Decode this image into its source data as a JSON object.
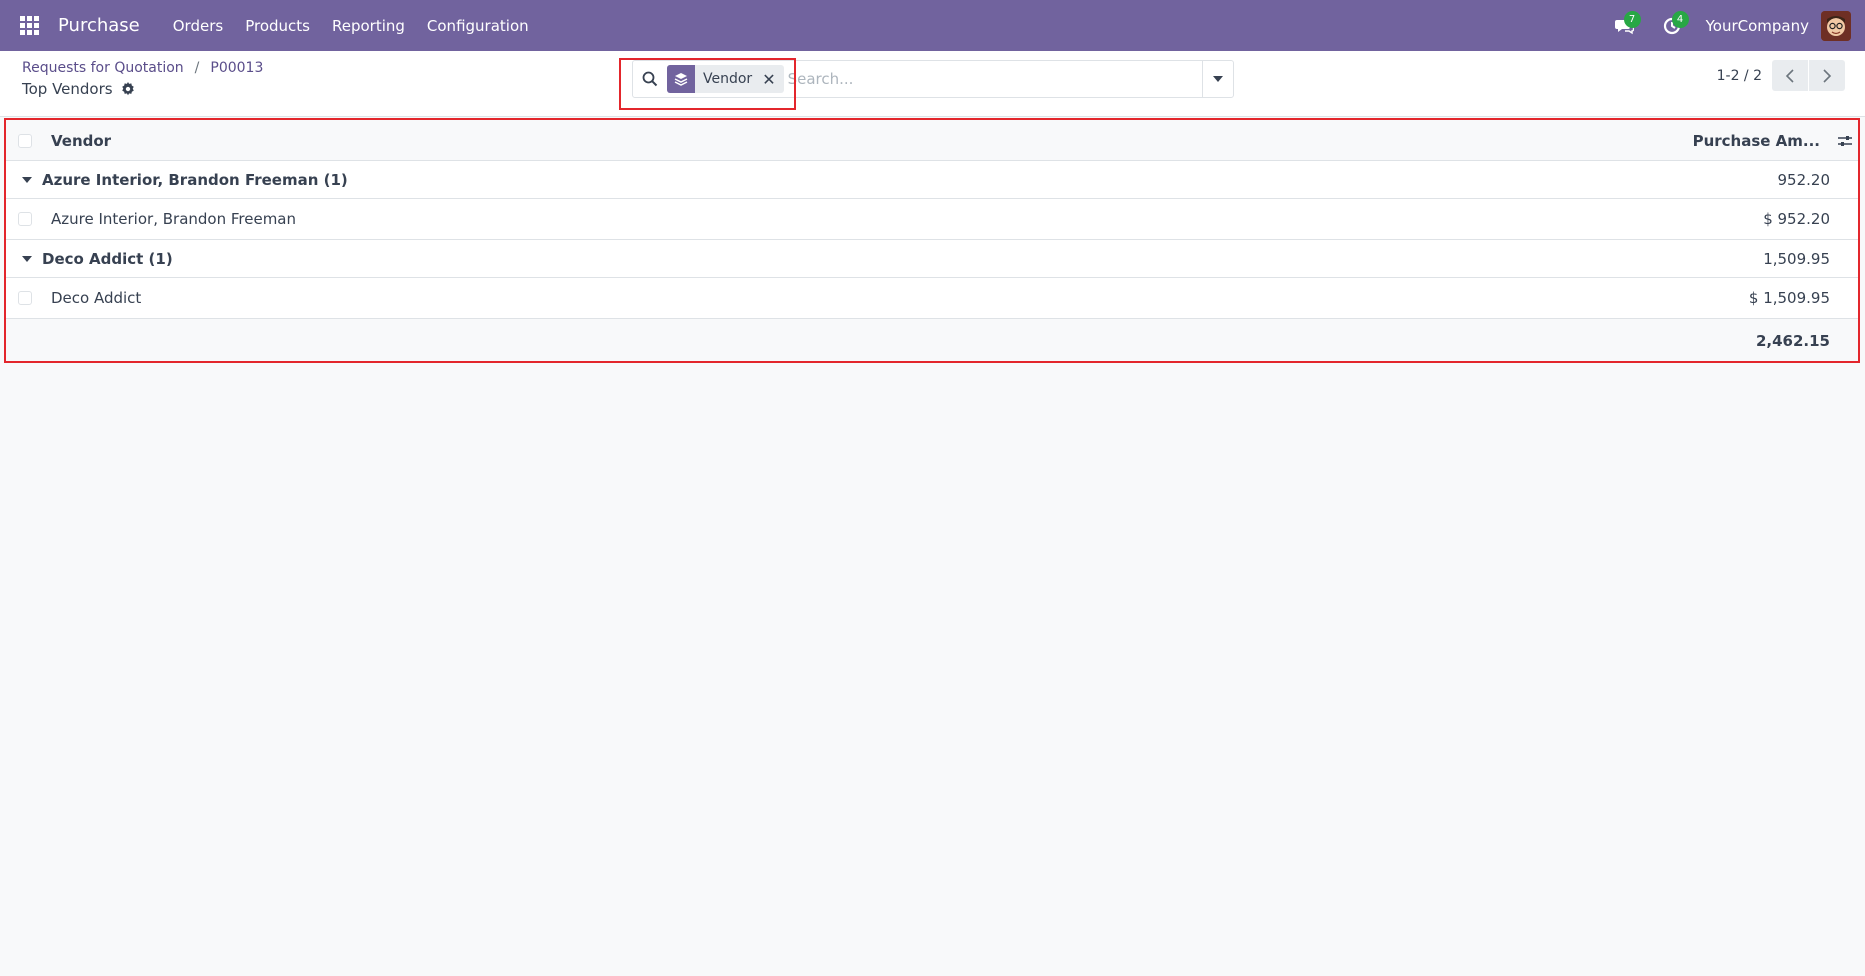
{
  "navbar": {
    "brand": "Purchase",
    "menu": [
      {
        "label": "Orders"
      },
      {
        "label": "Products"
      },
      {
        "label": "Reporting"
      },
      {
        "label": "Configuration"
      }
    ],
    "messages_count": "7",
    "activities_count": "4",
    "company": "YourCompany"
  },
  "breadcrumb": {
    "items": [
      "Requests for Quotation",
      "P00013"
    ],
    "separator": "/"
  },
  "page_title": "Top Vendors",
  "search": {
    "facet_label": "Vendor",
    "facet_remove": "✕",
    "placeholder": "Search..."
  },
  "pager": {
    "value": "1-2 / 2"
  },
  "list": {
    "columns": [
      "Vendor",
      "Purchase Am..."
    ],
    "groups": [
      {
        "name": "Azure Interior, Brandon Freeman (1)",
        "amount": "952.20",
        "records": [
          {
            "vendor": "Azure Interior, Brandon Freeman",
            "amount": "$ 952.20"
          }
        ]
      },
      {
        "name": "Deco Addict (1)",
        "amount": "1,509.95",
        "records": [
          {
            "vendor": "Deco Addict",
            "amount": "$ 1,509.95"
          }
        ]
      }
    ],
    "total": "2,462.15"
  },
  "colors": {
    "navbar": "#71639e",
    "highlight": "#e3262c",
    "badge": "#28a745"
  }
}
